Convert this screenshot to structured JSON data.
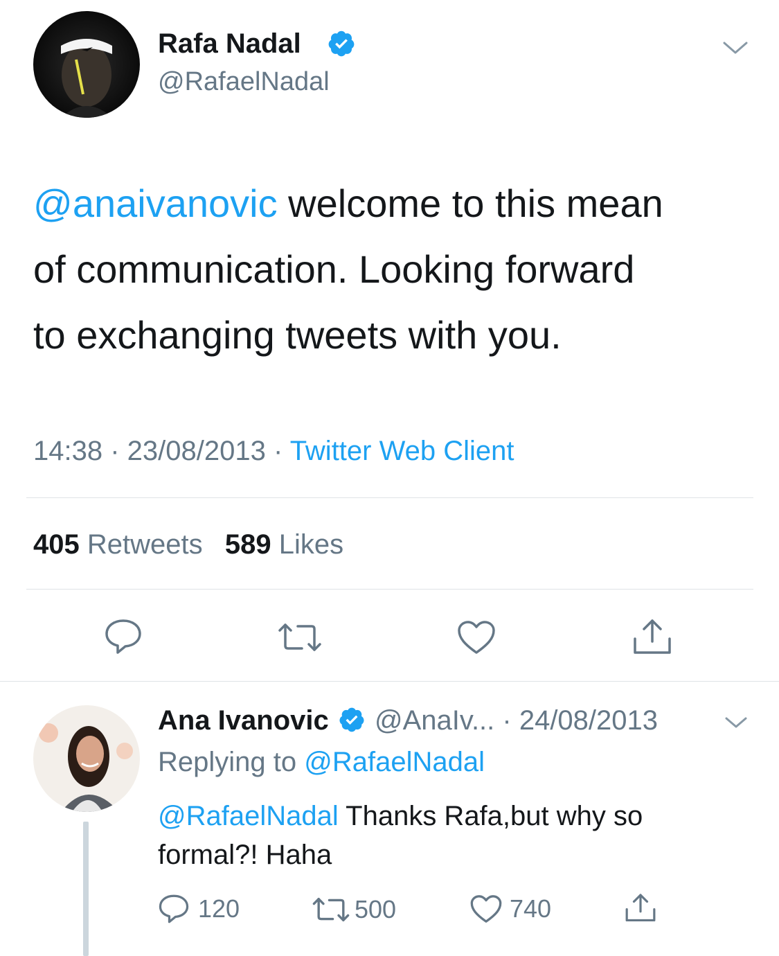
{
  "main_tweet": {
    "author_name": "Rafa Nadal",
    "handle": "@RafaelNadal",
    "mention": "@anaivanovic",
    "text_line1": " welcome to this mean",
    "text_line2": "of communication. Looking forward",
    "text_line3": "to exchanging tweets with you.",
    "time": "14:38",
    "sep1": " · ",
    "date": "23/08/2013",
    "sep2": " · ",
    "source": "Twitter Web Client",
    "retweet_count": "405",
    "retweet_label": " Retweets",
    "like_count": "589",
    "like_label": " Likes"
  },
  "reply": {
    "author_name": "Ana Ivanovic",
    "handle_truncated": "@AnaIv...",
    "date": " · 24/08/2013",
    "replying_label": "Replying to ",
    "replying_to": "@RafaelNadal",
    "mention": "@RafaelNadal",
    "text_line1": " Thanks Rafa,but why so",
    "text_line2": "formal?! Haha",
    "reply_count": "120",
    "retweet_count": "500",
    "like_count": "740"
  },
  "icons": {
    "verified": "verified-badge-icon",
    "chevron": "chevron-down-icon",
    "reply": "reply-bubble-icon",
    "retweet": "retweet-icon",
    "like": "heart-icon",
    "share": "share-icon"
  },
  "colors": {
    "link": "#1da1f2",
    "muted": "#657786",
    "text": "#14171a"
  }
}
